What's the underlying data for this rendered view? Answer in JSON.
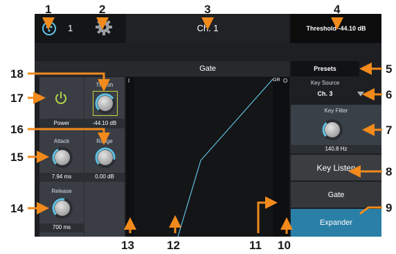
{
  "header": {
    "input_number": "1",
    "channel_title": "Ch. 1",
    "threshold_readout": "Threshold -44.10 dB"
  },
  "tab_bar": {
    "gate_label": "Gate",
    "presets_label": "Presets"
  },
  "controls": {
    "power": {
      "label": "Power"
    },
    "thresh": {
      "label": "Thresh",
      "value": "-44.10 dB",
      "level": 0.72
    },
    "attack": {
      "label": "Attack",
      "value": "7.94 ms",
      "level": 0.4
    },
    "range": {
      "label": "Range",
      "value": "0.00 dB",
      "level": 0.88
    },
    "release": {
      "label": "Release",
      "value": "700 ms",
      "level": 0.55
    }
  },
  "graph": {
    "left_meter_label": "I",
    "gr_meter_label": "GR",
    "out_meter_label": "O"
  },
  "right_panel": {
    "key_source_label": "Key Source",
    "key_source_value": "Ch. 3",
    "key_filter_label": "Key Filter",
    "key_filter_value": "140.8 Hz",
    "key_filter_level": 0.35,
    "key_listen_label": "Key Listen",
    "gate_button_label": "Gate",
    "expander_button_label": "Expander"
  },
  "callouts": {
    "c1": "1",
    "c2": "2",
    "c3": "3",
    "c4": "4",
    "c5": "5",
    "c6": "6",
    "c7": "7",
    "c8": "8",
    "c9": "9",
    "c10": "10",
    "c11": "11",
    "c12": "12",
    "c13": "13",
    "c14": "14",
    "c15": "15",
    "c16": "16",
    "c17": "17",
    "c18": "18"
  },
  "colors": {
    "accent_cyan": "#5fc3e4",
    "callout_orange": "#f28a1c",
    "expander_active": "#2a7fa6",
    "panel_dark": "#1d1f22",
    "panel_mid": "#3a3e44"
  }
}
